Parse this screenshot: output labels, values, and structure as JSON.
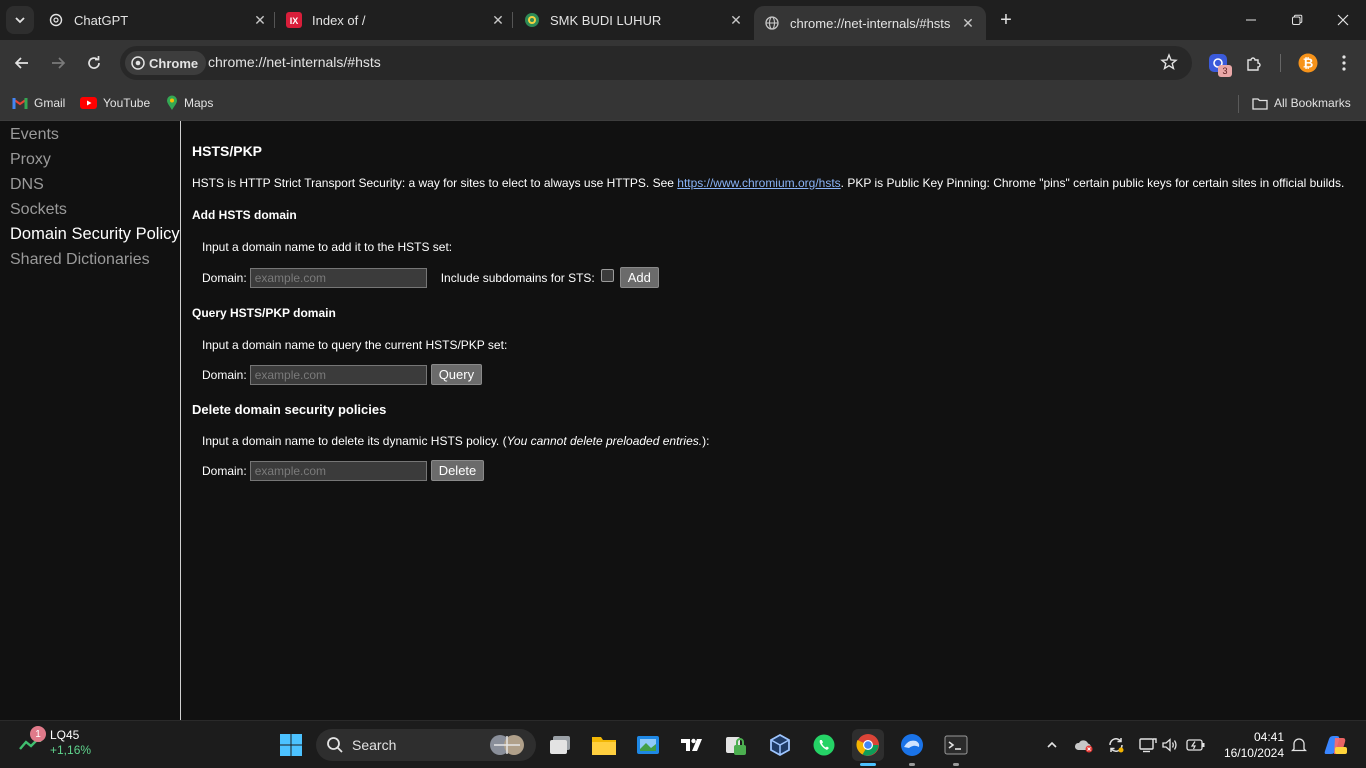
{
  "browser": {
    "tabs": [
      {
        "title": "ChatGPT",
        "icon": "chatgpt-icon"
      },
      {
        "title": "Index of /",
        "icon": "index-icon"
      },
      {
        "title": "SMK BUDI LUHUR",
        "icon": "school-icon"
      },
      {
        "title": "chrome://net-internals/#hsts",
        "icon": "globe-icon",
        "active": true
      }
    ],
    "chip_label": "Chrome",
    "url": "chrome://net-internals/#hsts",
    "extension_badge": "3",
    "bookmarks": [
      {
        "label": "Gmail",
        "icon": "gmail-icon"
      },
      {
        "label": "YouTube",
        "icon": "youtube-icon"
      },
      {
        "label": "Maps",
        "icon": "maps-icon"
      }
    ],
    "all_bookmarks": "All Bookmarks"
  },
  "sidebar": {
    "items": [
      "Events",
      "Proxy",
      "DNS",
      "Sockets",
      "Domain Security Policy",
      "Shared Dictionaries"
    ],
    "selected": "Domain Security Policy"
  },
  "main": {
    "title": "HSTS/PKP",
    "desc_before": "HSTS is HTTP Strict Transport Security: a way for sites to elect to always use HTTPS. See ",
    "desc_link": "https://www.chromium.org/hsts",
    "desc_after": ". PKP is Public Key Pinning: Chrome \"pins\" certain public keys for certain sites in official builds.",
    "add": {
      "heading": "Add HSTS domain",
      "instruction": "Input a domain name to add it to the HSTS set:",
      "domain_label": "Domain:",
      "placeholder": "example.com",
      "subdomains_label": "Include subdomains for STS:",
      "button": "Add"
    },
    "query": {
      "heading": "Query HSTS/PKP domain",
      "instruction": "Input a domain name to query the current HSTS/PKP set:",
      "domain_label": "Domain:",
      "placeholder": "example.com",
      "button": "Query"
    },
    "delete": {
      "heading": "Delete domain security policies",
      "instruction_before": "Input a domain name to delete its dynamic HSTS policy. (",
      "instruction_italic": "You cannot delete preloaded entries.",
      "instruction_after": "):",
      "domain_label": "Domain:",
      "placeholder": "example.com",
      "button": "Delete"
    }
  },
  "taskbar": {
    "weather_badge": "1",
    "stock_name": "LQ45",
    "stock_change": "+1,16%",
    "search_label": "Search",
    "time": "04:41",
    "date": "16/10/2024"
  }
}
